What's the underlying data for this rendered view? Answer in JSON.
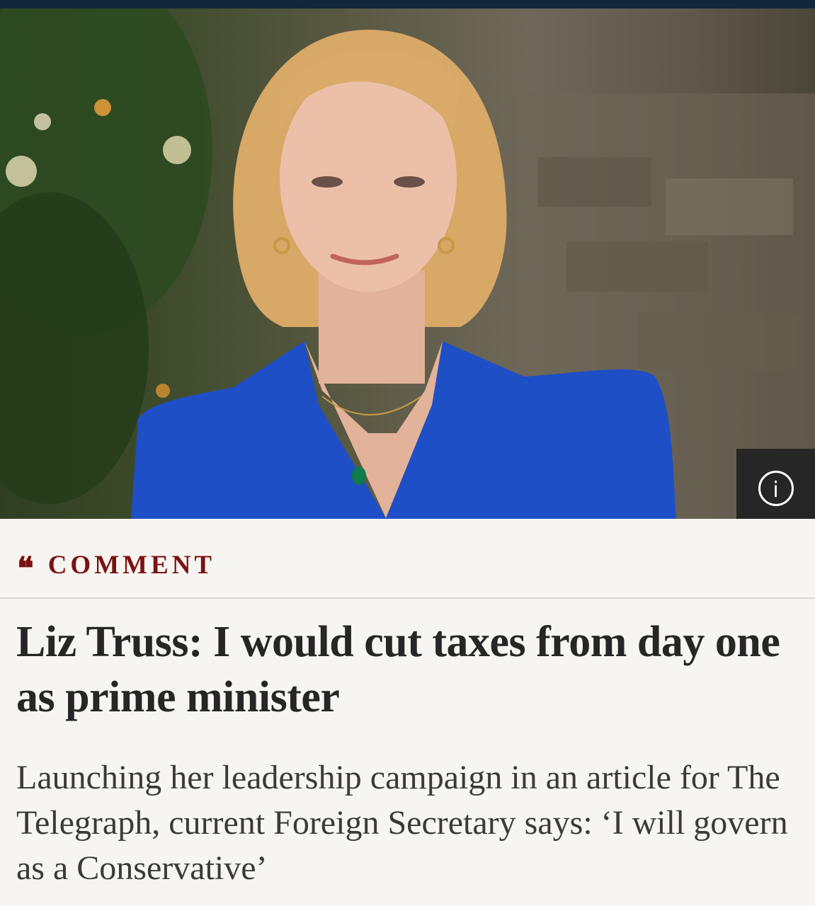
{
  "hero": {
    "image_alt": "Portrait of Liz Truss in a blue jacket in front of a garden wall",
    "info_icon": "info-icon",
    "info_glyph": "i"
  },
  "section": {
    "quote_glyph": "❝",
    "label": "COMMENT"
  },
  "article": {
    "headline": "Liz Truss: I would cut taxes from day one as prime minister",
    "standfirst": "Launching her leadership campaign in an article for The Telegraph, current Foreign Secretary says: ‘I will govern as a Conservative’"
  },
  "colors": {
    "accent": "#7b1212",
    "topbar": "#14263a",
    "background": "#f7f5f2"
  }
}
